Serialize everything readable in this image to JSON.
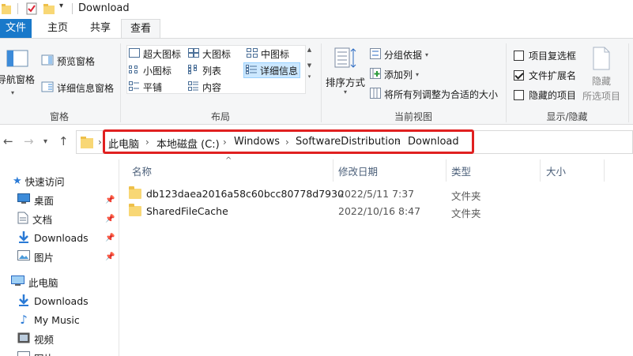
{
  "window": {
    "title": "Download"
  },
  "ribbon": {
    "tabs": [
      {
        "label": "文件",
        "active": false
      },
      {
        "label": "主页",
        "active": false
      },
      {
        "label": "共享",
        "active": false
      },
      {
        "label": "查看",
        "active": true
      }
    ],
    "panes": {
      "nav_pane": "导航窗格",
      "preview_pane": "预览窗格",
      "details_pane": "详细信息窗格",
      "group_label": "窗格"
    },
    "layout": {
      "items": [
        {
          "label": "超大图标",
          "selected": false
        },
        {
          "label": "大图标",
          "selected": false
        },
        {
          "label": "中图标",
          "selected": false
        },
        {
          "label": "小图标",
          "selected": false
        },
        {
          "label": "列表",
          "selected": false
        },
        {
          "label": "详细信息",
          "selected": true
        },
        {
          "label": "平铺",
          "selected": false
        },
        {
          "label": "内容",
          "selected": false
        }
      ],
      "group_label": "布局"
    },
    "current_view": {
      "sort_by": "排序方式",
      "group_by": "分组依据",
      "add_columns": "添加列",
      "size_columns": "将所有列调整为合适的大小",
      "group_label": "当前视图"
    },
    "show_hide": {
      "item_checkboxes": {
        "label": "项目复选框",
        "checked": false
      },
      "file_extensions": {
        "label": "文件扩展名",
        "checked": true
      },
      "hidden_items": {
        "label": "隐藏的项目",
        "checked": false
      },
      "hide": "隐藏",
      "hide_selected": "所选项目",
      "group_label": "显示/隐藏"
    }
  },
  "address": {
    "crumbs": [
      "此电脑",
      "本地磁盘 (C:)",
      "Windows",
      "SoftwareDistribution",
      "Download"
    ],
    "highlight_color": "#e02020"
  },
  "nav": {
    "quick_access": "快速访问",
    "items": [
      {
        "label": "桌面",
        "pinned": true
      },
      {
        "label": "文档",
        "pinned": true
      },
      {
        "label": "Downloads",
        "pinned": true
      },
      {
        "label": "图片",
        "pinned": true
      }
    ],
    "this_pc": "此电脑",
    "pc_items": [
      {
        "label": "Downloads"
      },
      {
        "label": "My Music"
      },
      {
        "label": "视频"
      },
      {
        "label": "图片"
      }
    ]
  },
  "list": {
    "columns": [
      "名称",
      "修改日期",
      "类型",
      "大小"
    ],
    "rows": [
      {
        "name": "db123daea2016a58c60bcc80778d7930",
        "date": "2022/5/11 7:37",
        "type": "文件夹",
        "size": ""
      },
      {
        "name": "SharedFileCache",
        "date": "2022/10/16 8:47",
        "type": "文件夹",
        "size": ""
      }
    ]
  }
}
